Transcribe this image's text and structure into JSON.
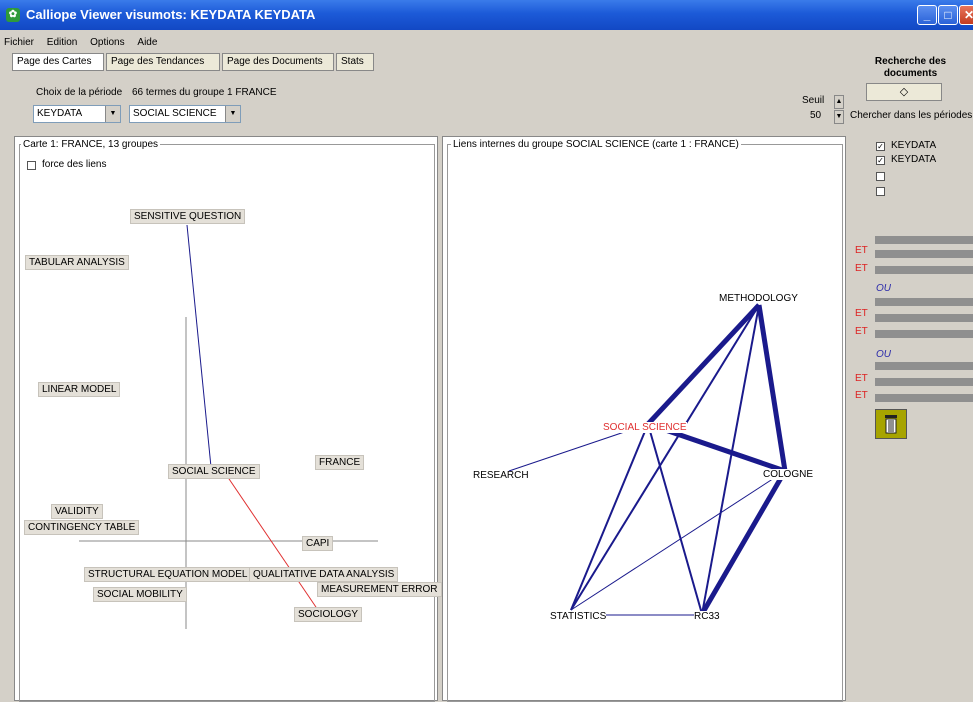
{
  "window": {
    "title": "Calliope Viewer visumots: KEYDATA KEYDATA"
  },
  "menu": [
    "Fichier",
    "Edition",
    "Options",
    "Aide"
  ],
  "tabs": [
    "Page des Cartes",
    "Page des Tendances",
    "Page des Documents",
    "Stats"
  ],
  "controls": {
    "period_label": "Choix de la période",
    "terms_label": "66 termes du groupe 1 FRANCE",
    "period_select": "KEYDATA",
    "group_select": "SOCIAL SCIENCE",
    "seuil_label": "Seuil",
    "seuil_value": "50"
  },
  "left_panel": {
    "legend": "Carte 1: FRANCE, 13 groupes",
    "checkbox_label": "force des liens",
    "nodes": [
      "SENSITIVE QUESTION",
      "TABULAR ANALYSIS",
      "LINEAR MODEL",
      "SOCIAL SCIENCE",
      "FRANCE",
      "VALIDITY",
      "CONTINGENCY TABLE",
      "CAPI",
      "STRUCTURAL EQUATION MODEL",
      "QUALITATIVE DATA ANALYSIS",
      "MEASUREMENT ERROR",
      "SOCIAL MOBILITY",
      "SOCIOLOGY"
    ]
  },
  "right_panel": {
    "legend": "Liens internes du groupe SOCIAL SCIENCE (carte 1 : FRANCE)",
    "nodes": [
      "METHODOLOGY",
      "SOCIAL SCIENCE",
      "RESEARCH",
      "COLOGNE",
      "STATISTICS",
      "RC33"
    ]
  },
  "search": {
    "title": "Recherche des documents",
    "search_in_label": "Chercher dans les périodes",
    "periods": [
      {
        "label": "KEYDATA",
        "checked": true
      },
      {
        "label": "KEYDATA",
        "checked": true
      },
      {
        "label": "",
        "checked": false
      },
      {
        "label": "",
        "checked": false
      }
    ],
    "operators": {
      "et": "ET",
      "ou": "OU"
    }
  },
  "colors": {
    "titlebar": "#1c5ad8",
    "link": "#1a1a8c",
    "highlight": "#e03030"
  }
}
